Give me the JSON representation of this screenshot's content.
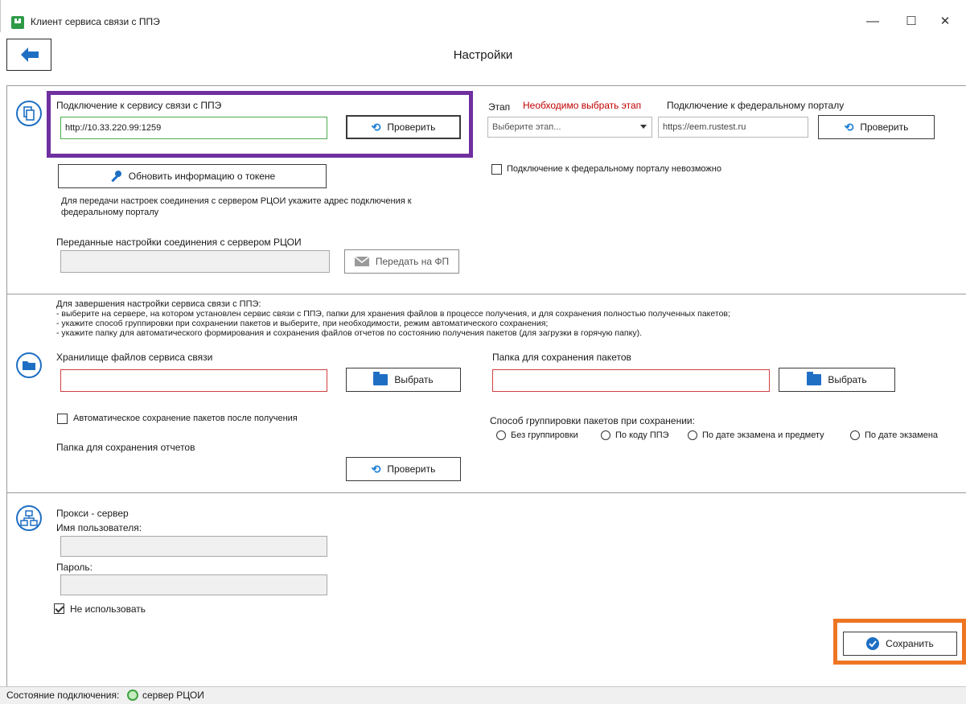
{
  "window": {
    "title": "Клиент сервиса связи с ППЭ",
    "minimize": "—",
    "maximize": "☐",
    "close": "✕"
  },
  "page_title": "Настройки",
  "section1": {
    "connection_label": "Подключение к сервису связи с ППЭ",
    "connection_value": "http://10.33.220.99:1259",
    "check_button": "Проверить",
    "token_button": "Обновить информацию о токене",
    "transfer_note": "Для передачи настроек соединения с сервером РЦОИ укажите адрес подключения к федеральному порталу",
    "transferred_label": "Переданные настройки соединения с сервером РЦОИ",
    "transferred_value": "",
    "send_button": "Передать на ФП",
    "stage_label": "Этап",
    "stage_warning": "Необходимо выбрать этап",
    "stage_select": "Выберите этап...",
    "federal_label": "Подключение к федеральному порталу",
    "federal_value": "https://eem.rustest.ru",
    "federal_check_button": "Проверить",
    "federal_impossible": "Подключение к федеральному порталу невозможно"
  },
  "section2": {
    "instructions": [
      "Для завершения настройки сервиса связи с ППЭ:",
      "- выберите на сервере, на котором установлен сервис связи с ППЭ, папки для хранения файлов в процессе получения, и для сохранения полностью полученных пакетов;",
      "- укажите способ группировки при сохранении пакетов и выберите, при необходимости, режим автоматического сохранения;",
      "- укажите папку для автоматического формирования и сохранения файлов отчетов по состоянию получения пакетов (для загрузки в горячую папку)."
    ],
    "storage_label": "Хранилище файлов сервиса связи",
    "storage_value": "",
    "storage_button": "Выбрать",
    "packages_label": "Папка для сохранения пакетов",
    "packages_value": "",
    "packages_button": "Выбрать",
    "auto_save_label": "Автоматическое сохранение пакетов после получения",
    "auto_save_checked": false,
    "reports_label": "Папка для сохранения отчетов",
    "reports_button": "Проверить",
    "grouping_label": "Способ группировки пакетов при сохранении:",
    "grouping_options": [
      "Без группировки",
      "По коду ППЭ",
      "По дате экзамена и предмету",
      "По дате экзамена"
    ]
  },
  "section3": {
    "proxy_label": "Прокси - сервер",
    "username_label": "Имя пользователя:",
    "username_value": "",
    "password_label": "Пароль:",
    "password_value": "",
    "not_use_label": "Не использовать",
    "not_use_checked": true
  },
  "save_button": "Сохранить",
  "status": {
    "label": "Состояние подключения:",
    "server": "сервер РЦОИ"
  },
  "colors": {
    "purple_highlight": "#7030a0",
    "orange_highlight": "#ee7623",
    "accent_blue": "#1e6fc4",
    "warning_red": "#c00000",
    "status_green": "#3fa33f"
  }
}
